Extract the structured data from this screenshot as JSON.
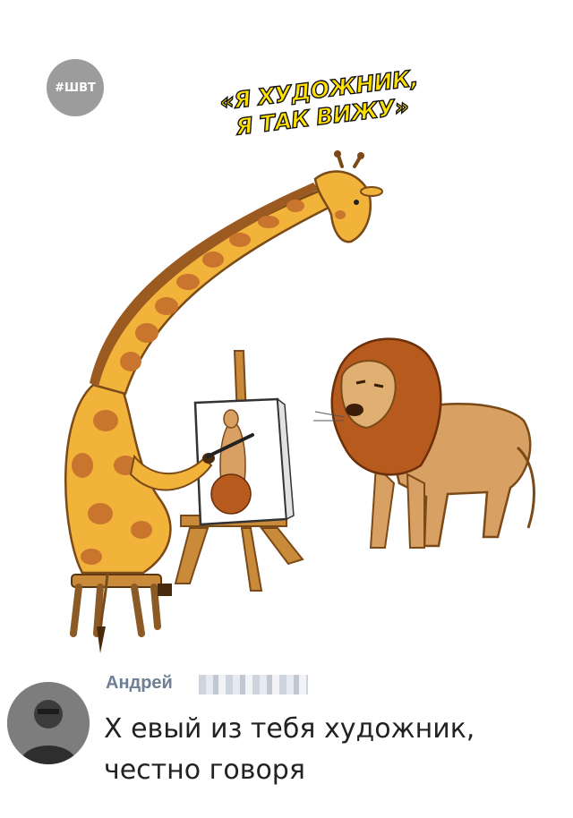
{
  "badge": {
    "text": "#ШВТ"
  },
  "caption": {
    "line1": "«Я ХУДОЖНИК,",
    "line2": "Я ТАК ВИЖУ»"
  },
  "comment": {
    "author": "Андрей",
    "text_line1": "Х  евый из тебя художник,",
    "text_line2": "честно говоря"
  },
  "colors": {
    "giraffe": "#f2b33a",
    "spots": "#c9752e",
    "lion_body": "#d9a063",
    "mane": "#b65a1e",
    "wood": "#c98a3a",
    "caption_fill": "#ffe100"
  }
}
